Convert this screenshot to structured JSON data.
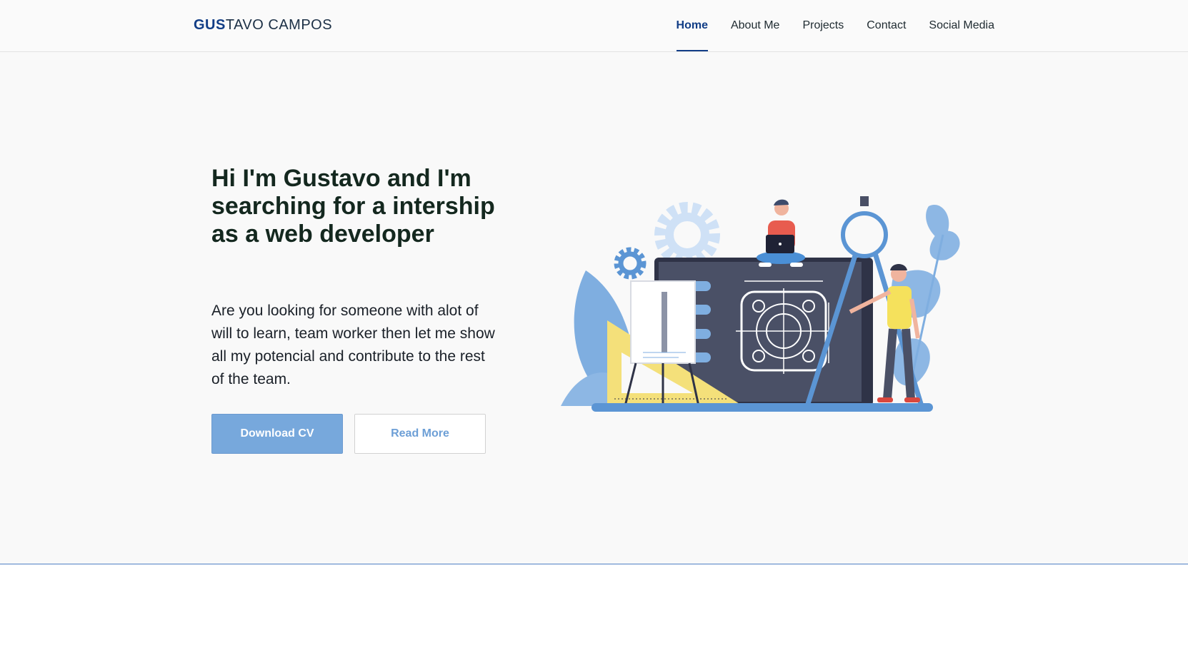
{
  "header": {
    "logo_accent": "GUS",
    "logo_rest": "TAVO CAMPOS",
    "nav": [
      {
        "label": "Home",
        "active": true
      },
      {
        "label": "About Me",
        "active": false
      },
      {
        "label": "Projects",
        "active": false
      },
      {
        "label": "Contact",
        "active": false
      },
      {
        "label": "Social Media",
        "active": false
      }
    ]
  },
  "hero": {
    "headline": "Hi I'm Gustavo and I'm searching for a intership as a web developer",
    "description": "Are you looking for someone with alot of will to learn, team worker then let me show all my potencial and contribute to the rest of the team.",
    "primary_button": "Download CV",
    "secondary_button": "Read More",
    "illustration": "web-developer-illustration"
  },
  "colors": {
    "brand_navy": "#113d86",
    "button_blue": "#77a8dc",
    "illustration_dark": "#4a5066",
    "illustration_yellow": "#f4e07a",
    "illustration_light_blue": "#cfe1f6"
  }
}
